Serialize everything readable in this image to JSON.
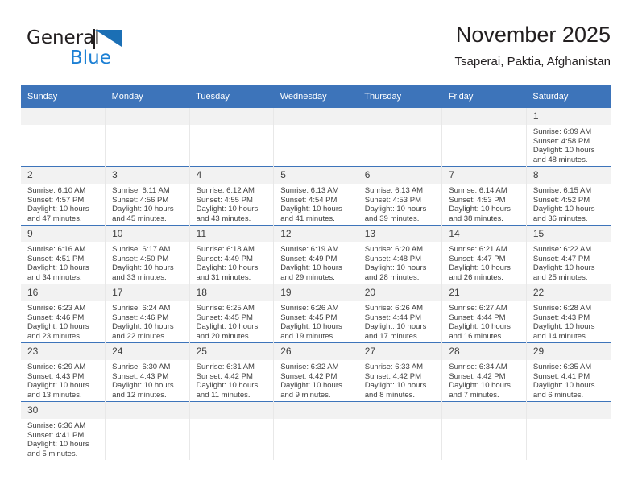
{
  "brand": {
    "name_top": "General",
    "name_bottom": "Blue",
    "flag_icon": "blue-triangle-flag-icon",
    "color_black": "#231f20",
    "color_blue": "#1b7fd4"
  },
  "header": {
    "title": "November 2025",
    "subtitle": "Tsaperai, Paktia, Afghanistan"
  },
  "theme": {
    "header_blue": "#3d74ba",
    "daynum_band": "#f2f2f2",
    "text": "#3f3f3f"
  },
  "calendar": {
    "weekday_headers": [
      "Sunday",
      "Monday",
      "Tuesday",
      "Wednesday",
      "Thursday",
      "Friday",
      "Saturday"
    ],
    "labels": {
      "sunrise": "Sunrise:",
      "sunset": "Sunset:",
      "daylight": "Daylight:"
    },
    "weeks": [
      [
        {
          "day": "",
          "sunrise": "",
          "sunset": "",
          "daylight": ""
        },
        {
          "day": "",
          "sunrise": "",
          "sunset": "",
          "daylight": ""
        },
        {
          "day": "",
          "sunrise": "",
          "sunset": "",
          "daylight": ""
        },
        {
          "day": "",
          "sunrise": "",
          "sunset": "",
          "daylight": ""
        },
        {
          "day": "",
          "sunrise": "",
          "sunset": "",
          "daylight": ""
        },
        {
          "day": "",
          "sunrise": "",
          "sunset": "",
          "daylight": ""
        },
        {
          "day": "1",
          "sunrise": "Sunrise: 6:09 AM",
          "sunset": "Sunset: 4:58 PM",
          "daylight": "Daylight: 10 hours and 48 minutes."
        }
      ],
      [
        {
          "day": "2",
          "sunrise": "Sunrise: 6:10 AM",
          "sunset": "Sunset: 4:57 PM",
          "daylight": "Daylight: 10 hours and 47 minutes."
        },
        {
          "day": "3",
          "sunrise": "Sunrise: 6:11 AM",
          "sunset": "Sunset: 4:56 PM",
          "daylight": "Daylight: 10 hours and 45 minutes."
        },
        {
          "day": "4",
          "sunrise": "Sunrise: 6:12 AM",
          "sunset": "Sunset: 4:55 PM",
          "daylight": "Daylight: 10 hours and 43 minutes."
        },
        {
          "day": "5",
          "sunrise": "Sunrise: 6:13 AM",
          "sunset": "Sunset: 4:54 PM",
          "daylight": "Daylight: 10 hours and 41 minutes."
        },
        {
          "day": "6",
          "sunrise": "Sunrise: 6:13 AM",
          "sunset": "Sunset: 4:53 PM",
          "daylight": "Daylight: 10 hours and 39 minutes."
        },
        {
          "day": "7",
          "sunrise": "Sunrise: 6:14 AM",
          "sunset": "Sunset: 4:53 PM",
          "daylight": "Daylight: 10 hours and 38 minutes."
        },
        {
          "day": "8",
          "sunrise": "Sunrise: 6:15 AM",
          "sunset": "Sunset: 4:52 PM",
          "daylight": "Daylight: 10 hours and 36 minutes."
        }
      ],
      [
        {
          "day": "9",
          "sunrise": "Sunrise: 6:16 AM",
          "sunset": "Sunset: 4:51 PM",
          "daylight": "Daylight: 10 hours and 34 minutes."
        },
        {
          "day": "10",
          "sunrise": "Sunrise: 6:17 AM",
          "sunset": "Sunset: 4:50 PM",
          "daylight": "Daylight: 10 hours and 33 minutes."
        },
        {
          "day": "11",
          "sunrise": "Sunrise: 6:18 AM",
          "sunset": "Sunset: 4:49 PM",
          "daylight": "Daylight: 10 hours and 31 minutes."
        },
        {
          "day": "12",
          "sunrise": "Sunrise: 6:19 AM",
          "sunset": "Sunset: 4:49 PM",
          "daylight": "Daylight: 10 hours and 29 minutes."
        },
        {
          "day": "13",
          "sunrise": "Sunrise: 6:20 AM",
          "sunset": "Sunset: 4:48 PM",
          "daylight": "Daylight: 10 hours and 28 minutes."
        },
        {
          "day": "14",
          "sunrise": "Sunrise: 6:21 AM",
          "sunset": "Sunset: 4:47 PM",
          "daylight": "Daylight: 10 hours and 26 minutes."
        },
        {
          "day": "15",
          "sunrise": "Sunrise: 6:22 AM",
          "sunset": "Sunset: 4:47 PM",
          "daylight": "Daylight: 10 hours and 25 minutes."
        }
      ],
      [
        {
          "day": "16",
          "sunrise": "Sunrise: 6:23 AM",
          "sunset": "Sunset: 4:46 PM",
          "daylight": "Daylight: 10 hours and 23 minutes."
        },
        {
          "day": "17",
          "sunrise": "Sunrise: 6:24 AM",
          "sunset": "Sunset: 4:46 PM",
          "daylight": "Daylight: 10 hours and 22 minutes."
        },
        {
          "day": "18",
          "sunrise": "Sunrise: 6:25 AM",
          "sunset": "Sunset: 4:45 PM",
          "daylight": "Daylight: 10 hours and 20 minutes."
        },
        {
          "day": "19",
          "sunrise": "Sunrise: 6:26 AM",
          "sunset": "Sunset: 4:45 PM",
          "daylight": "Daylight: 10 hours and 19 minutes."
        },
        {
          "day": "20",
          "sunrise": "Sunrise: 6:26 AM",
          "sunset": "Sunset: 4:44 PM",
          "daylight": "Daylight: 10 hours and 17 minutes."
        },
        {
          "day": "21",
          "sunrise": "Sunrise: 6:27 AM",
          "sunset": "Sunset: 4:44 PM",
          "daylight": "Daylight: 10 hours and 16 minutes."
        },
        {
          "day": "22",
          "sunrise": "Sunrise: 6:28 AM",
          "sunset": "Sunset: 4:43 PM",
          "daylight": "Daylight: 10 hours and 14 minutes."
        }
      ],
      [
        {
          "day": "23",
          "sunrise": "Sunrise: 6:29 AM",
          "sunset": "Sunset: 4:43 PM",
          "daylight": "Daylight: 10 hours and 13 minutes."
        },
        {
          "day": "24",
          "sunrise": "Sunrise: 6:30 AM",
          "sunset": "Sunset: 4:43 PM",
          "daylight": "Daylight: 10 hours and 12 minutes."
        },
        {
          "day": "25",
          "sunrise": "Sunrise: 6:31 AM",
          "sunset": "Sunset: 4:42 PM",
          "daylight": "Daylight: 10 hours and 11 minutes."
        },
        {
          "day": "26",
          "sunrise": "Sunrise: 6:32 AM",
          "sunset": "Sunset: 4:42 PM",
          "daylight": "Daylight: 10 hours and 9 minutes."
        },
        {
          "day": "27",
          "sunrise": "Sunrise: 6:33 AM",
          "sunset": "Sunset: 4:42 PM",
          "daylight": "Daylight: 10 hours and 8 minutes."
        },
        {
          "day": "28",
          "sunrise": "Sunrise: 6:34 AM",
          "sunset": "Sunset: 4:42 PM",
          "daylight": "Daylight: 10 hours and 7 minutes."
        },
        {
          "day": "29",
          "sunrise": "Sunrise: 6:35 AM",
          "sunset": "Sunset: 4:41 PM",
          "daylight": "Daylight: 10 hours and 6 minutes."
        }
      ],
      [
        {
          "day": "30",
          "sunrise": "Sunrise: 6:36 AM",
          "sunset": "Sunset: 4:41 PM",
          "daylight": "Daylight: 10 hours and 5 minutes."
        },
        {
          "day": "",
          "sunrise": "",
          "sunset": "",
          "daylight": ""
        },
        {
          "day": "",
          "sunrise": "",
          "sunset": "",
          "daylight": ""
        },
        {
          "day": "",
          "sunrise": "",
          "sunset": "",
          "daylight": ""
        },
        {
          "day": "",
          "sunrise": "",
          "sunset": "",
          "daylight": ""
        },
        {
          "day": "",
          "sunrise": "",
          "sunset": "",
          "daylight": ""
        },
        {
          "day": "",
          "sunrise": "",
          "sunset": "",
          "daylight": ""
        }
      ]
    ]
  }
}
